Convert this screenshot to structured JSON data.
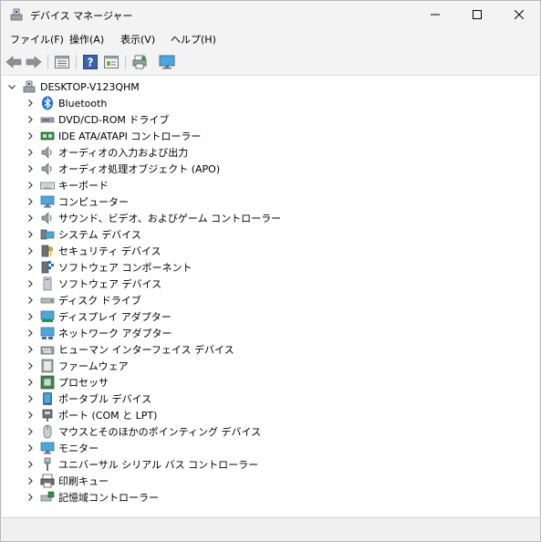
{
  "window": {
    "title": "デバイス マネージャー",
    "app_icon": "device-manager-icon"
  },
  "menu": [
    {
      "label": "ファイル(F)"
    },
    {
      "label": "操作(A)"
    },
    {
      "label": "表示(V)"
    },
    {
      "label": "ヘルプ(H)"
    }
  ],
  "toolbar": [
    {
      "name": "back-icon"
    },
    {
      "name": "forward-icon"
    },
    {
      "name": "properties-icon"
    },
    {
      "name": "help-icon"
    },
    {
      "name": "view-icon"
    },
    {
      "name": "print-icon"
    },
    {
      "name": "monitor-icon"
    }
  ],
  "tree": {
    "root": {
      "label": "DESKTOP-V123QHM",
      "icon": "computer-icon"
    },
    "items": [
      {
        "label": "Bluetooth",
        "icon": "bluetooth-icon"
      },
      {
        "label": "DVD/CD-ROM ドライブ",
        "icon": "dvd-drive-icon"
      },
      {
        "label": "IDE ATA/ATAPI コントローラー",
        "icon": "ide-controller-icon"
      },
      {
        "label": "オーディオの入力および出力",
        "icon": "speaker-icon"
      },
      {
        "label": "オーディオ処理オブジェクト (APO)",
        "icon": "speaker-icon"
      },
      {
        "label": "キーボード",
        "icon": "keyboard-icon"
      },
      {
        "label": "コンピューター",
        "icon": "monitor-icon"
      },
      {
        "label": "サウンド、ビデオ、およびゲーム コントローラー",
        "icon": "speaker-icon"
      },
      {
        "label": "システム デバイス",
        "icon": "system-device-icon"
      },
      {
        "label": "セキュリティ デバイス",
        "icon": "security-key-icon"
      },
      {
        "label": "ソフトウェア コンポーネント",
        "icon": "software-component-icon"
      },
      {
        "label": "ソフトウェア デバイス",
        "icon": "software-device-icon"
      },
      {
        "label": "ディスク ドライブ",
        "icon": "disk-drive-icon"
      },
      {
        "label": "ディスプレイ アダプター",
        "icon": "display-adapter-icon"
      },
      {
        "label": "ネットワーク アダプター",
        "icon": "network-adapter-icon"
      },
      {
        "label": "ヒューマン インターフェイス デバイス",
        "icon": "hid-icon"
      },
      {
        "label": "ファームウェア",
        "icon": "firmware-icon"
      },
      {
        "label": "プロセッサ",
        "icon": "processor-icon"
      },
      {
        "label": "ポータブル デバイス",
        "icon": "portable-device-icon"
      },
      {
        "label": "ポート (COM と LPT)",
        "icon": "port-icon"
      },
      {
        "label": "マウスとそのほかのポインティング デバイス",
        "icon": "mouse-icon"
      },
      {
        "label": "モニター",
        "icon": "monitor-icon"
      },
      {
        "label": "ユニバーサル シリアル バス コントローラー",
        "icon": "usb-icon"
      },
      {
        "label": "印刷キュー",
        "icon": "printer-icon"
      },
      {
        "label": "記憶域コントローラー",
        "icon": "storage-controller-icon"
      }
    ]
  },
  "colors": {
    "accent": "#0078d4",
    "window_bg": "#f3f3f3",
    "content_bg": "#ffffff"
  }
}
